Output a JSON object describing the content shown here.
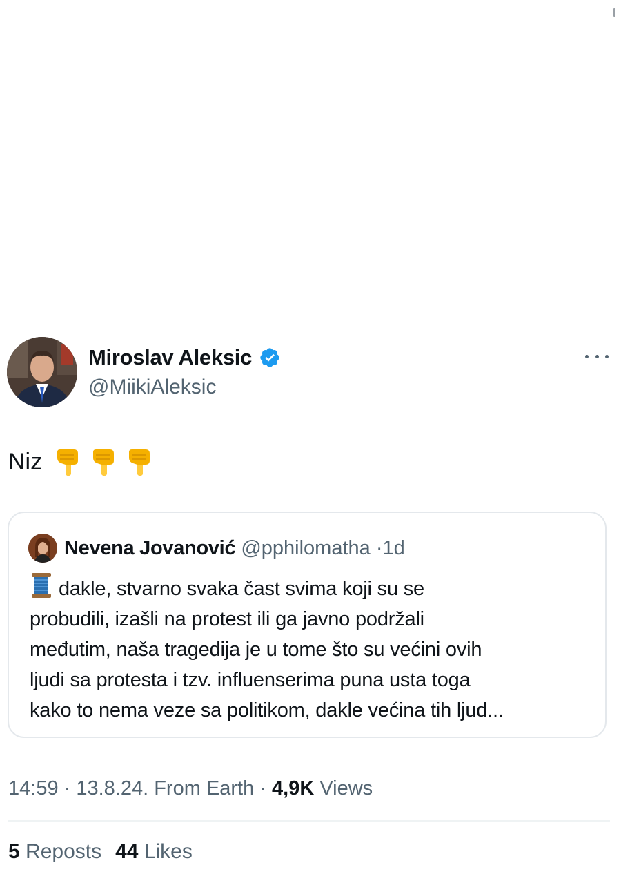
{
  "tweet": {
    "author_name": "Miroslav Aleksic",
    "author_handle": "@MiikiAleksic",
    "verified": true,
    "text": "Niz",
    "emojis": [
      "backhand-index-pointing-down",
      "backhand-index-pointing-down",
      "backhand-index-pointing-down"
    ],
    "icons": {
      "more": "more-options-icon",
      "verified": "verified-badge-icon",
      "avatar": "avatar"
    }
  },
  "quote": {
    "author_name": "Nevena Jovanović",
    "author_handle": "@pphilomatha",
    "separator": "·",
    "time": "1d",
    "emoji": "spool-of-thread",
    "lines": [
      "dakle, stvarno svaka čast svima koji su se",
      "probudili, izašli na protest ili ga javno podržali",
      "međutim, naša tragedija je u tome što su većini ovih",
      "ljudi sa protesta i tzv. influenserima puna usta toga",
      "kako to nema veze sa politikom, dakle većina tih ljud..."
    ]
  },
  "meta": {
    "time_date": "14:59 · 13.8.24. From Earth · ",
    "views_count": "4,9K",
    "views_label": "Views"
  },
  "stats": {
    "reposts_count": "5",
    "reposts_label": "Reposts",
    "likes_count": "44",
    "likes_label": "Likes"
  },
  "colors": {
    "text_primary": "#0f1419",
    "text_secondary": "#536471",
    "verified_blue": "#1d9bf0",
    "border": "#e4e8ec"
  }
}
